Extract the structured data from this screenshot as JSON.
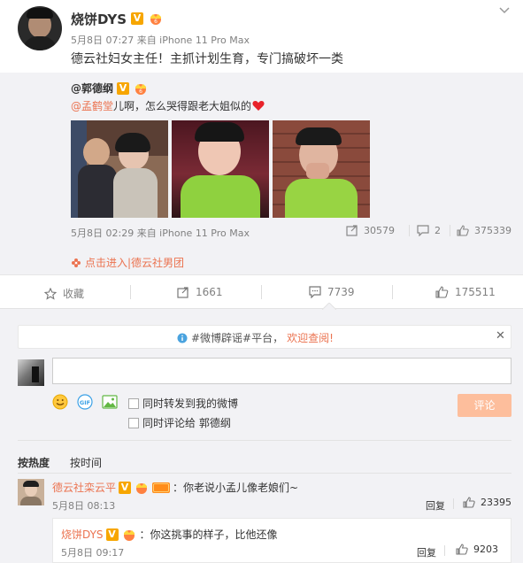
{
  "post": {
    "author": "烧饼DYS",
    "meta": "5月8日 07:27 来自 iPhone 11 Pro Max",
    "text": "德云社妇女主任！主抓计划生育，专门搞破坏一类",
    "more_icon": "chevron-down-icon"
  },
  "repost": {
    "author": "@郭德纲",
    "mention": "@孟鹤堂",
    "text": " 儿啊，怎么哭得跟老大姐似的",
    "meta": "5月8日 02:29 来自 iPhone 11 Pro Max",
    "reposts": "30579",
    "comments": "2",
    "likes": "375339",
    "group_link": "点击进入|德云社男团"
  },
  "actions": {
    "favorite": "收藏",
    "repost": "1661",
    "comment": "7739",
    "like": "175511"
  },
  "notice": {
    "tag": "#微博辟谣#平台，",
    "link": "欢迎查阅!"
  },
  "composer": {
    "placeholder": "",
    "option_repost": "同时转发到我的微博",
    "option_comment": "同时评论给 郭德纲",
    "submit": "评论"
  },
  "sort": {
    "hot": "按热度",
    "time": "按时间"
  },
  "comments": [
    {
      "author": "德云社栾云平",
      "text": "：你老说小孟儿像老娘们~",
      "time": "5月8日 08:13",
      "reply": "回复",
      "likes": "23395"
    }
  ],
  "replies": [
    {
      "author": "烧饼DYS",
      "text": "：你这挑事的样子，比他还像",
      "time": "5月8日 09:17",
      "reply": "回复",
      "likes": "9203"
    }
  ],
  "colors": {
    "accent": "#eb7350",
    "link": "#eb7350",
    "vip": "#f7a600",
    "button": "#fdbe9c"
  }
}
